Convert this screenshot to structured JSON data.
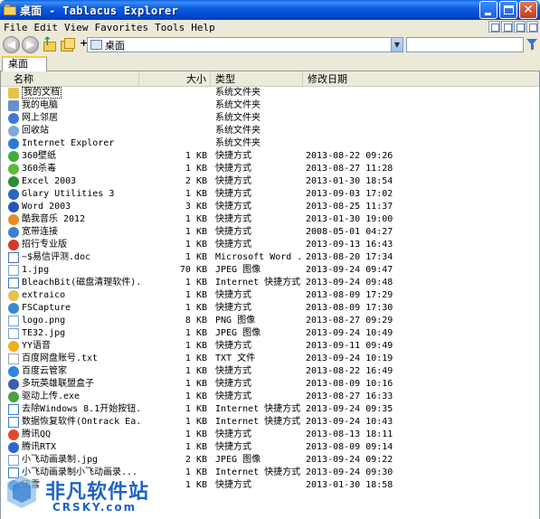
{
  "window": {
    "title": "桌面 - Tablacus Explorer"
  },
  "menu": [
    "File",
    "Edit",
    "View",
    "Favorites",
    "Tools",
    "Help"
  ],
  "address": {
    "new_tab": "+",
    "path": "桌面",
    "dropdown": "▼",
    "search_value": ""
  },
  "tabs": [
    {
      "label": "桌面",
      "active": true
    }
  ],
  "columns": {
    "name": "名称",
    "size": "大小",
    "type": "类型",
    "date": "修改日期"
  },
  "files": [
    {
      "name": "我的文档",
      "size": "",
      "type": "系统文件夹",
      "date": "",
      "icon": "my-documents-icon",
      "color": "#e8c14a"
    },
    {
      "name": "我的电脑",
      "size": "",
      "type": "系统文件夹",
      "date": "",
      "icon": "my-computer-icon",
      "color": "#6a8fc8"
    },
    {
      "name": "网上邻居",
      "size": "",
      "type": "系统文件夹",
      "date": "",
      "icon": "network-icon",
      "color": "#3d7ad6"
    },
    {
      "name": "回收站",
      "size": "",
      "type": "系统文件夹",
      "date": "",
      "icon": "recycle-bin-icon",
      "color": "#7fa8d8"
    },
    {
      "name": "Internet Explorer",
      "size": "",
      "type": "系统文件夹",
      "date": "",
      "icon": "ie-icon",
      "color": "#2b7bd6"
    },
    {
      "name": "360壁纸",
      "size": "1 KB",
      "type": "快捷方式",
      "date": "2013-08-22 09:26",
      "icon": "app-360-wallpaper-icon",
      "color": "#3fae3a"
    },
    {
      "name": "360杀毒",
      "size": "1 KB",
      "type": "快捷方式",
      "date": "2013-08-27 11:28",
      "icon": "app-360-antivirus-icon",
      "color": "#5fb83a"
    },
    {
      "name": "Excel 2003",
      "size": "2 KB",
      "type": "快捷方式",
      "date": "2013-01-30 18:54",
      "icon": "excel-icon",
      "color": "#2f8b3a"
    },
    {
      "name": "Glary Utilities 3",
      "size": "1 KB",
      "type": "快捷方式",
      "date": "2013-09-03 17:02",
      "icon": "glary-icon",
      "color": "#2a66c4"
    },
    {
      "name": "Word 2003",
      "size": "3 KB",
      "type": "快捷方式",
      "date": "2013-08-25 11:37",
      "icon": "word-icon",
      "color": "#2a55b8"
    },
    {
      "name": "酷我音乐 2012",
      "size": "1 KB",
      "type": "快捷方式",
      "date": "2013-01-30 19:00",
      "icon": "kuwo-music-icon",
      "color": "#f08a20"
    },
    {
      "name": "宽带连接",
      "size": "1 KB",
      "type": "快捷方式",
      "date": "2008-05-01 04:27",
      "icon": "broadband-icon",
      "color": "#3a82d0"
    },
    {
      "name": "招行专业版",
      "size": "1 KB",
      "type": "快捷方式",
      "date": "2013-09-13 16:43",
      "icon": "cmb-bank-icon",
      "color": "#d33a2a"
    },
    {
      "name": "~$易信评测.doc",
      "size": "1 KB",
      "type": "Microsoft Word ...",
      "date": "2013-08-20 17:34",
      "icon": "doc-file-icon",
      "color": "#4a6fc0"
    },
    {
      "name": "1.jpg",
      "size": "70 KB",
      "type": "JPEG 图像",
      "date": "2013-09-24 09:47",
      "icon": "jpg-file-icon",
      "color": "#7c9fd0"
    },
    {
      "name": "BleachBit(磁盘清理软件)...",
      "size": "1 KB",
      "type": "Internet 快捷方式",
      "date": "2013-09-24 09:48",
      "icon": "url-icon",
      "color": "#3a7ad4"
    },
    {
      "name": "extraico",
      "size": "1 KB",
      "type": "快捷方式",
      "date": "2013-08-09 17:29",
      "icon": "folder-shortcut-icon",
      "color": "#e8c14a"
    },
    {
      "name": "FSCapture",
      "size": "1 KB",
      "type": "快捷方式",
      "date": "2013-08-09 17:30",
      "icon": "fscapture-icon",
      "color": "#3a8ad0"
    },
    {
      "name": "logo.png",
      "size": "8 KB",
      "type": "PNG 图像",
      "date": "2013-08-27 09:29",
      "icon": "png-file-icon",
      "color": "#7c9fd0"
    },
    {
      "name": "TE32.jpg",
      "size": "1 KB",
      "type": "JPEG 图像",
      "date": "2013-09-24 10:49",
      "icon": "jpg-file-icon",
      "color": "#7c9fd0"
    },
    {
      "name": "YY语音",
      "size": "1 KB",
      "type": "快捷方式",
      "date": "2013-09-11 09:49",
      "icon": "yy-voice-icon",
      "color": "#f2b01e"
    },
    {
      "name": "百度网盘账号.txt",
      "size": "1 KB",
      "type": "TXT 文件",
      "date": "2013-09-24 10:19",
      "icon": "txt-file-icon",
      "color": "#9aa7b8"
    },
    {
      "name": "百度云管家",
      "size": "1 KB",
      "type": "快捷方式",
      "date": "2013-08-22 16:49",
      "icon": "baidu-cloud-icon",
      "color": "#2a86e0"
    },
    {
      "name": "多玩英雄联盟盒子",
      "size": "1 KB",
      "type": "快捷方式",
      "date": "2013-08-09 10:16",
      "icon": "lol-box-icon",
      "color": "#3a5fa8"
    },
    {
      "name": "驱动上传.exe",
      "size": "1 KB",
      "type": "快捷方式",
      "date": "2013-08-27 16:33",
      "icon": "exe-icon",
      "color": "#4aa040"
    },
    {
      "name": "去除Windows 8.1开始按钮...",
      "size": "1 KB",
      "type": "Internet 快捷方式",
      "date": "2013-09-24 09:35",
      "icon": "url-icon",
      "color": "#3a7ad4"
    },
    {
      "name": "数据恢复软件(Ontrack Ea...",
      "size": "1 KB",
      "type": "Internet 快捷方式",
      "date": "2013-09-24 10:43",
      "icon": "url-icon",
      "color": "#3a7ad4"
    },
    {
      "name": "腾讯QQ",
      "size": "1 KB",
      "type": "快捷方式",
      "date": "2013-08-13 18:11",
      "icon": "qq-icon",
      "color": "#e04a2a"
    },
    {
      "name": "腾讯RTX",
      "size": "1 KB",
      "type": "快捷方式",
      "date": "2013-08-09 09:14",
      "icon": "rtx-icon",
      "color": "#2a66d4"
    },
    {
      "name": "小飞动画录制.jpg",
      "size": "2 KB",
      "type": "JPEG 图像",
      "date": "2013-09-24 09:22",
      "icon": "jpg-file-icon",
      "color": "#7c9fd0"
    },
    {
      "name": "小飞动画录制小飞动画录...",
      "size": "1 KB",
      "type": "Internet 快捷方式",
      "date": "2013-09-24 09:30",
      "icon": "url-icon",
      "color": "#3a7ad4"
    },
    {
      "name": "迅雷",
      "size": "1 KB",
      "type": "快捷方式",
      "date": "2013-01-30 18:58",
      "icon": "xunlei-icon",
      "color": "#2a7ad8"
    }
  ],
  "watermark": {
    "cn": "非凡软件站",
    "en": "CRSKY.com"
  }
}
